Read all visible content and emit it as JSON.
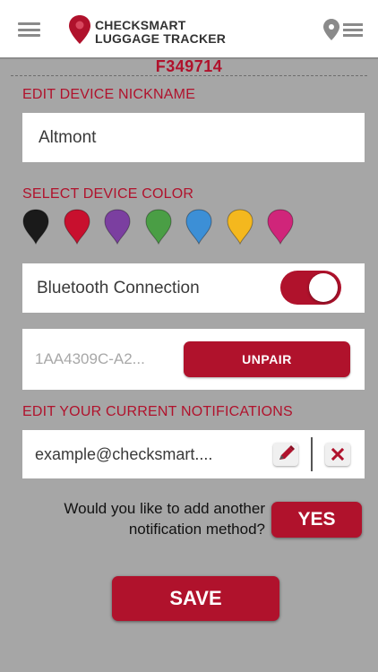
{
  "header": {
    "logo_line1": "CHECKSMART",
    "logo_line2": "LUGGAGE TRACKER"
  },
  "device_id": "F349714",
  "nickname": {
    "label": "EDIT DEVICE NICKNAME",
    "value": "Altmont"
  },
  "colors": {
    "label": "SELECT DEVICE COLOR",
    "swatches": [
      "#1a1a1a",
      "#c8102e",
      "#7b3fa0",
      "#4a9e45",
      "#3c8fd6",
      "#f4b81e",
      "#d0257a"
    ]
  },
  "bluetooth": {
    "label": "Bluetooth Connection",
    "enabled": true
  },
  "device": {
    "uuid": "1AA4309C-A2...",
    "unpair_label": "UNPAIR"
  },
  "notifications": {
    "label": "EDIT YOUR CURRENT NOTIFICATIONS",
    "items": [
      {
        "value": "example@checksmart...."
      }
    ]
  },
  "add_method": {
    "question_line1": "Would you like to add another",
    "question_line2": "notification method?",
    "yes_label": "YES"
  },
  "save_label": "SAVE",
  "theme": {
    "accent": "#b0122c",
    "background": "#a6a6a6"
  }
}
